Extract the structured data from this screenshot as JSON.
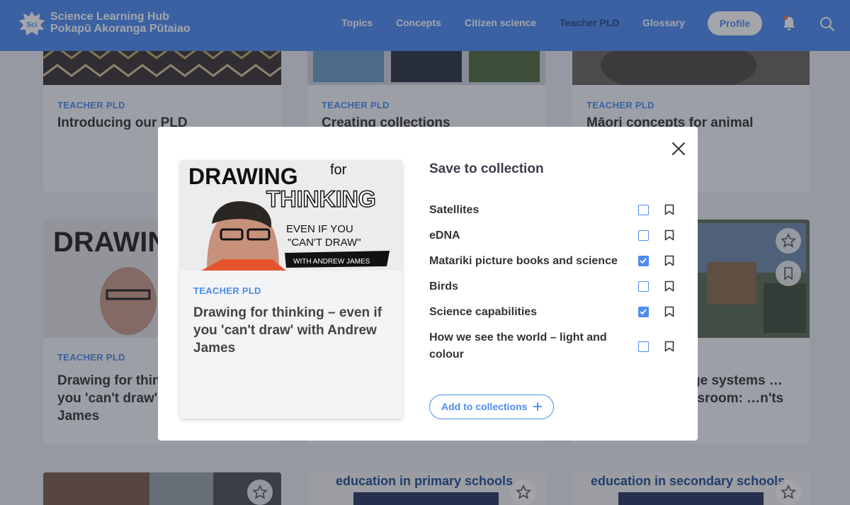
{
  "header": {
    "logo_text": "Sci",
    "site_name_line1": "Science Learning Hub",
    "site_name_line2": "Pokapū Akoranga Pūtaiao",
    "nav": [
      "Topics",
      "Concepts",
      "Citizen science",
      "Teacher PLD",
      "Glossary"
    ],
    "profile_label": "Profile"
  },
  "background_cards": [
    {
      "tag": "TEACHER PLD",
      "title": "Introducing our PLD"
    },
    {
      "tag": "TEACHER PLD",
      "title": "Creating collections"
    },
    {
      "tag": "TEACHER PLD",
      "title": "Māori concepts for animal"
    },
    {
      "tag": "TEACHER PLD",
      "title": "Drawing for thinking – even if you 'can't draw' with Andrew James"
    },
    {
      "tag": "",
      "title": "…ge systems …lassroom: …n'ts"
    },
    {
      "tag": "",
      "title": ""
    },
    {
      "tag": "",
      "title": "education in primary schools"
    },
    {
      "tag": "",
      "title": "education in secondary schools"
    }
  ],
  "modal": {
    "preview_image_text": {
      "line1": "DRAWING",
      "line1b": "for",
      "line2": "THINKING",
      "line3": "EVEN IF YOU",
      "line4": "\"CAN'T DRAW\"",
      "banner": "WITH ANDREW JAMES"
    },
    "preview_tag": "TEACHER PLD",
    "preview_title": "Drawing for thinking – even if you 'can't draw' with Andrew James",
    "save_title": "Save to collection",
    "collections": [
      {
        "label": "Satellites",
        "checked": false
      },
      {
        "label": "eDNA",
        "checked": false
      },
      {
        "label": "Matariki picture books and science",
        "checked": true
      },
      {
        "label": "Birds",
        "checked": false
      },
      {
        "label": "Science capabilities",
        "checked": true
      },
      {
        "label": "How we see the world – light and colour",
        "checked": false
      }
    ],
    "add_button_label": "Add to collections"
  },
  "colors": {
    "brand": "#4d8bef",
    "overlay": "rgba(35,40,55,0.42)"
  }
}
